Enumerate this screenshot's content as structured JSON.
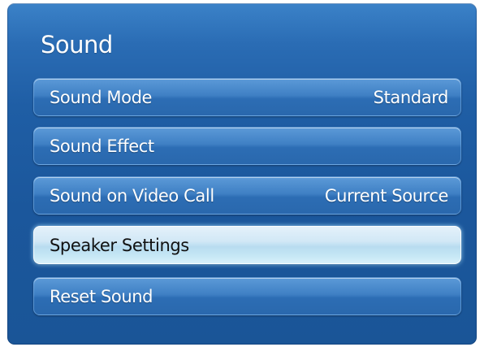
{
  "menu": {
    "title": "Sound",
    "items": [
      {
        "label": "Sound Mode",
        "value": "Standard"
      },
      {
        "label": "Sound Effect",
        "value": ""
      },
      {
        "label": "Sound on Video Call",
        "value": "Current Source"
      },
      {
        "label": "Speaker Settings",
        "value": "",
        "selected": true
      },
      {
        "label": "Reset Sound",
        "value": ""
      }
    ]
  },
  "colors": {
    "panel": "#1f5ea5",
    "item": "#3f80c4",
    "item_selected": "#d2e8f6",
    "text": "#ffffff",
    "text_selected": "#111111"
  }
}
